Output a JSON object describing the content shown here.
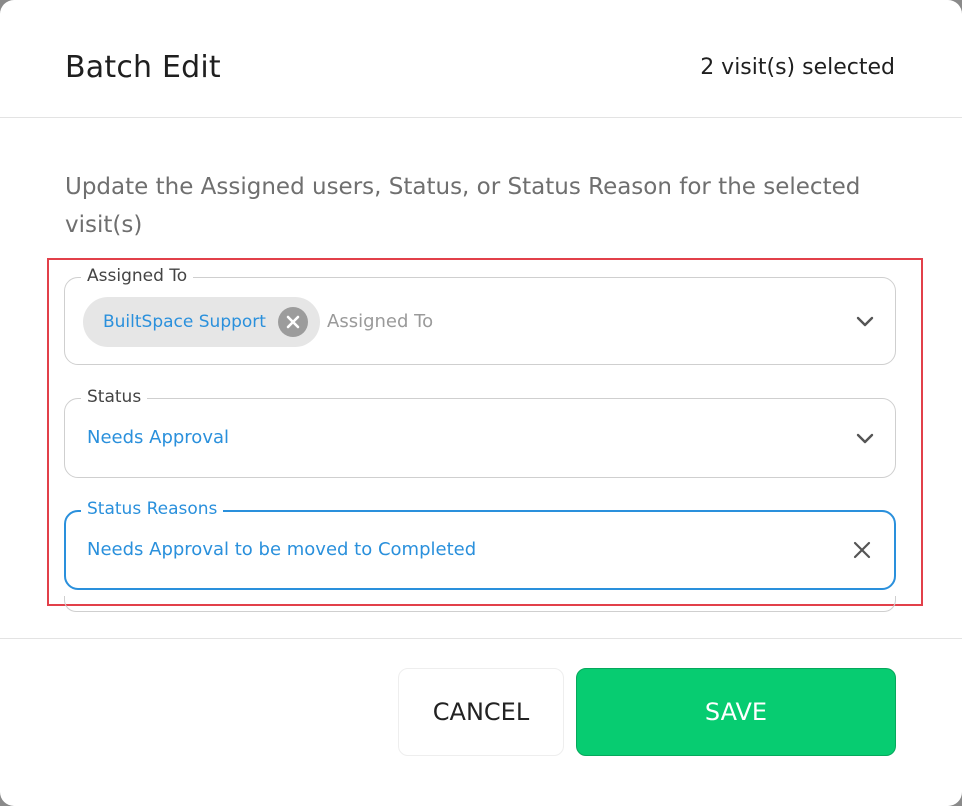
{
  "dialog": {
    "title": "Batch Edit",
    "selected_count": "2 visit(s) selected",
    "description": "Update the Assigned users, Status, or Status Reason for the selected visit(s)"
  },
  "fields": {
    "assigned_to": {
      "label": "Assigned To",
      "chips": [
        "BuiltSpace Support"
      ],
      "placeholder": "Assigned To"
    },
    "status": {
      "label": "Status",
      "value": "Needs Approval"
    },
    "status_reasons": {
      "label": "Status Reasons",
      "value": "Needs Approval to be moved to Completed"
    }
  },
  "buttons": {
    "cancel_label": "CANCEL",
    "save_label": "SAVE"
  },
  "colors": {
    "accent": "#2a90dc",
    "save": "#07cc71",
    "highlight": "#e2404a"
  },
  "icons": {
    "chip_remove": "close-circle-icon",
    "dropdown": "chevron-down-icon",
    "clear": "close-icon"
  }
}
